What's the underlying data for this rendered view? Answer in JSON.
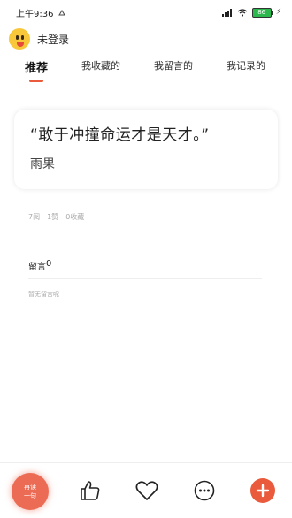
{
  "status_bar": {
    "time": "上午9:36",
    "battery_level": "86"
  },
  "user": {
    "name": "未登录"
  },
  "tabs": [
    {
      "label": "推荐",
      "active": true
    },
    {
      "label": "我收藏的",
      "active": false
    },
    {
      "label": "我留言的",
      "active": false
    },
    {
      "label": "我记录的",
      "active": false
    }
  ],
  "quote": {
    "text": "“敢于冲撞命运才是天才。”",
    "author": "雨果"
  },
  "stats": {
    "views": "7阅",
    "likes": "1赞",
    "favorites": "0收藏"
  },
  "comments": {
    "title": "留言",
    "count": "0",
    "empty_text": "暂无留言呢"
  },
  "bottom_bar": {
    "refresh_line1": "再读",
    "refresh_line2": "一句"
  },
  "colors": {
    "accent": "#ea5a3c",
    "refresh": "#ec6b55",
    "muted_text": "#aaaaaa"
  },
  "icons": [
    "avatar-emoji",
    "thumbs-up-icon",
    "heart-icon",
    "more-dots-icon",
    "plus-icon",
    "wifi-icon",
    "signal-icon",
    "battery-icon"
  ]
}
